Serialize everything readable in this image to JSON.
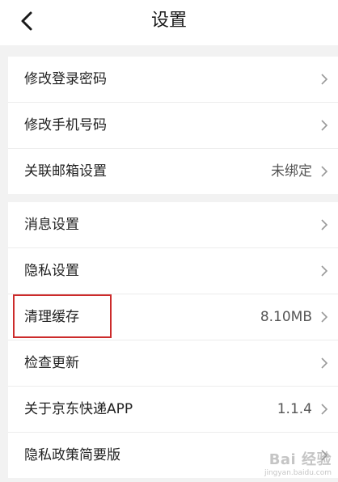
{
  "header": {
    "title": "设置",
    "back_icon": "chevron-left-icon"
  },
  "group1": [
    {
      "label": "修改登录密码",
      "value": ""
    },
    {
      "label": "修改手机号码",
      "value": ""
    },
    {
      "label": "关联邮箱设置",
      "value": "未绑定"
    }
  ],
  "group2": [
    {
      "label": "消息设置",
      "value": ""
    },
    {
      "label": "隐私设置",
      "value": ""
    },
    {
      "label": "清理缓存",
      "value": "8.10MB"
    },
    {
      "label": "检查更新",
      "value": ""
    },
    {
      "label": "关于京东快递APP",
      "value": "1.1.4"
    },
    {
      "label": "隐私政策简要版",
      "value": ""
    }
  ],
  "watermark": {
    "brand": "Bai 经验",
    "url": "jingyan.baidu.com"
  },
  "colors": {
    "highlight": "#cc2b2b",
    "background": "#f2f2f2"
  }
}
